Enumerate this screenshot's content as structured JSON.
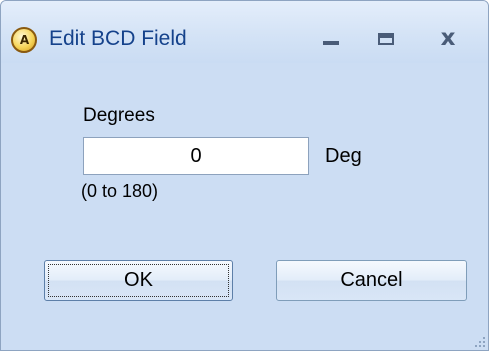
{
  "window": {
    "title": "Edit BCD Field",
    "app_icon_text": "A",
    "title_color": "#15428b",
    "background_color": "#ccddf3"
  },
  "titlebar_buttons": {
    "minimize_icon": "minimize-icon",
    "maximize_icon": "maximize-icon",
    "close_icon": "close-icon",
    "close_glyph": "x"
  },
  "form": {
    "field_label": "Degrees",
    "value": "0",
    "unit": "Deg",
    "range_hint": "(0 to 180)"
  },
  "buttons": {
    "ok_label": "OK",
    "cancel_label": "Cancel"
  }
}
